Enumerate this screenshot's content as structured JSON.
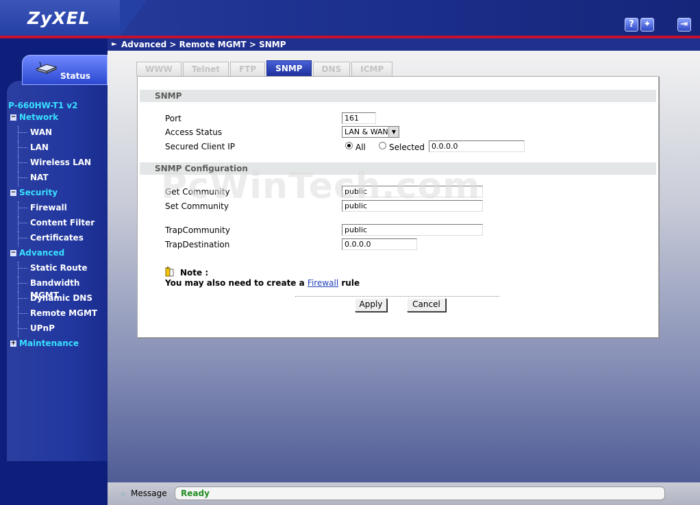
{
  "brand": {
    "logo": "ZyXEL",
    "accent": "#c8102e",
    "nav_cyan": "#38e0ff"
  },
  "header": {
    "help_icon": "question-icon",
    "wizard_icon": "wizard-icon",
    "logout_icon": "logout-icon"
  },
  "breadcrumb": "Advanced > Remote MGMT > SNMP",
  "sidebar": {
    "status_label": "Status",
    "model": "P-660HW-T1 v2",
    "groups": [
      {
        "label": "Network",
        "items": [
          "WAN",
          "LAN",
          "Wireless LAN",
          "NAT"
        ]
      },
      {
        "label": "Security",
        "items": [
          "Firewall",
          "Content Filter",
          "Certificates"
        ]
      },
      {
        "label": "Advanced",
        "items": [
          "Static Route",
          "Bandwidth MGMT",
          "Dynamic DNS",
          "Remote MGMT",
          "UPnP"
        ]
      },
      {
        "label": "Maintenance",
        "items": []
      }
    ]
  },
  "tabs": [
    "WWW",
    "Telnet",
    "FTP",
    "SNMP",
    "DNS",
    "ICMP"
  ],
  "active_tab": "SNMP",
  "snmp": {
    "section_title": "SNMP",
    "port_label": "Port",
    "port_value": "161",
    "access_label": "Access Status",
    "access_value": "LAN & WAN",
    "secured_label": "Secured Client IP",
    "radio_all": "All",
    "radio_selected": "Selected",
    "selected_ip": "0.0.0.0"
  },
  "config": {
    "section_title": "SNMP Configuration",
    "get_label": "Get Community",
    "get_value": "public",
    "set_label": "Set Community",
    "set_value": "public",
    "trapcomm_label": "TrapCommunity",
    "trapcomm_value": "public",
    "trapdest_label": "TrapDestination",
    "trapdest_value": "0.0.0.0"
  },
  "note": {
    "title": "Note :",
    "text_before": "You may also need to create a",
    "link": "Firewall",
    "text_after": "rule"
  },
  "buttons": {
    "apply": "Apply",
    "cancel": "Cancel"
  },
  "watermark": "PcWinTech.com",
  "statusbar": {
    "label": "Message",
    "value": "Ready"
  }
}
